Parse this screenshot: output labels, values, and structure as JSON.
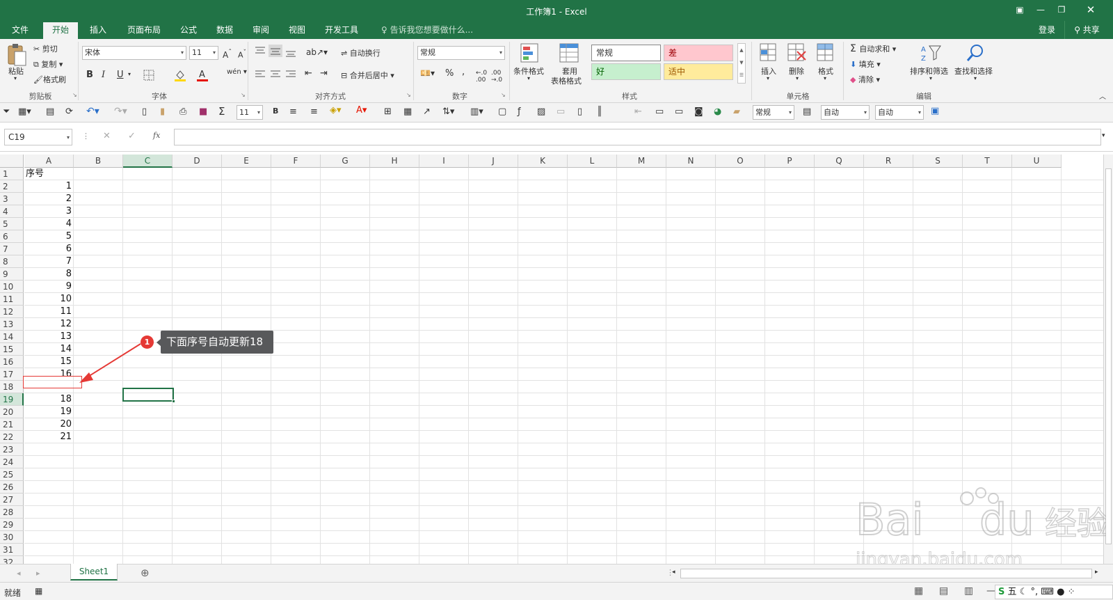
{
  "window": {
    "title": "工作簿1 - Excel",
    "login": "登录",
    "share": "共享"
  },
  "tabs": [
    "文件",
    "开始",
    "插入",
    "页面布局",
    "公式",
    "数据",
    "审阅",
    "视图",
    "开发工具"
  ],
  "tell_me": "告诉我您想要做什么...",
  "ribbon": {
    "clipboard": {
      "paste": "粘贴",
      "cut": "剪切",
      "copy": "复制",
      "format_painter": "格式刷",
      "label": "剪贴板"
    },
    "font": {
      "name": "宋体",
      "size": "11",
      "label": "字体",
      "bold": "B",
      "italic": "I",
      "underline": "U"
    },
    "alignment": {
      "wrap": "自动换行",
      "merge": "合并后居中",
      "label": "对齐方式"
    },
    "number": {
      "format": "常规",
      "label": "数字",
      "percent": "%"
    },
    "styles": {
      "conditional": "条件格式",
      "table_fmt_1": "套用",
      "table_fmt_2": "表格格式",
      "normal": "常规",
      "bad": "差",
      "good": "好",
      "neutral": "适中",
      "label": "样式"
    },
    "cells": {
      "insert": "插入",
      "delete": "删除",
      "format": "格式",
      "label": "单元格"
    },
    "editing": {
      "autosum": "自动求和",
      "fill": "填充",
      "clear": "清除",
      "sort": "排序和筛选",
      "find": "查找和选择",
      "label": "编辑"
    }
  },
  "qat": {
    "size": "11",
    "format": "常规",
    "auto1": "自动",
    "auto2": "自动"
  },
  "namebox": "C19",
  "columns": [
    "A",
    "B",
    "C",
    "D",
    "E",
    "F",
    "G",
    "H",
    "I",
    "J",
    "K",
    "L",
    "M",
    "N",
    "O",
    "P",
    "Q",
    "R",
    "S",
    "T",
    "U"
  ],
  "rows": [
    "1",
    "2",
    "3",
    "4",
    "5",
    "6",
    "7",
    "8",
    "9",
    "10",
    "11",
    "12",
    "13",
    "14",
    "15",
    "16",
    "17",
    "18",
    "19",
    "20",
    "21",
    "22",
    "23",
    "24",
    "25",
    "26",
    "27",
    "28",
    "29",
    "30",
    "31",
    "32"
  ],
  "cells_A": [
    "序号",
    "1",
    "2",
    "3",
    "4",
    "5",
    "6",
    "7",
    "8",
    "9",
    "10",
    "11",
    "12",
    "13",
    "14",
    "15",
    "16",
    "",
    "18",
    "19",
    "20",
    "21"
  ],
  "annotation": {
    "badge": "1",
    "text": "下面序号自动更新18"
  },
  "sheet": {
    "name": "Sheet1"
  },
  "status": {
    "ready": "就绪"
  },
  "watermark": {
    "text": "Baidu经验",
    "sub": "jingyan.baidu.com"
  },
  "colors": {
    "accent": "#217346",
    "annot_red": "#e53935"
  }
}
